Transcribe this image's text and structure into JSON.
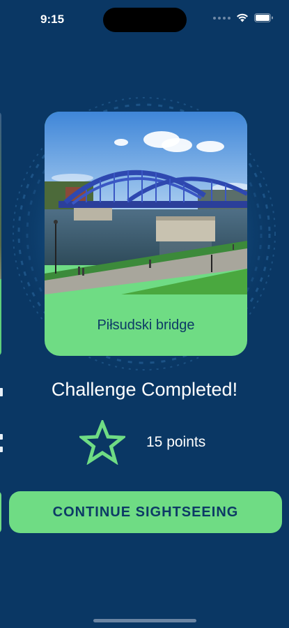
{
  "status_bar": {
    "time": "9:15"
  },
  "card": {
    "caption": "Piłsudski bridge",
    "image_description": "photo-of-blue-arched-bridge-over-river"
  },
  "result": {
    "title": "Challenge Completed!",
    "points_label": "15 points",
    "icon": "star-outline-icon"
  },
  "actions": {
    "continue_label": "CONTINUE SIGHTSEEING"
  },
  "colors": {
    "background": "#0a3764",
    "accent_green": "#6fdc84",
    "text_dark": "#0d3a66",
    "text_light": "#ffffff"
  }
}
